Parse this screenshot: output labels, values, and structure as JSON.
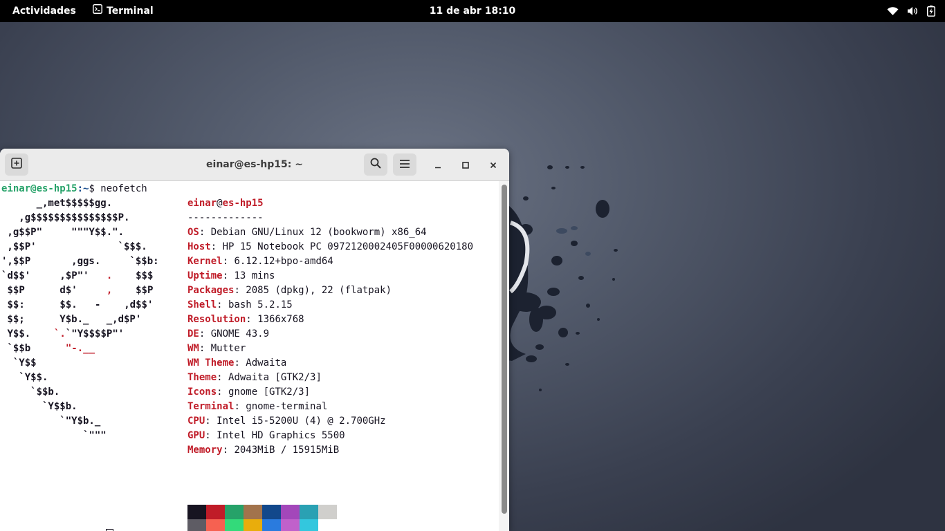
{
  "topbar": {
    "activities": "Actividades",
    "app_name": "Terminal",
    "clock": "11 de abr  18:10",
    "tray_icons": [
      "wifi-icon",
      "volume-icon",
      "battery-icon"
    ]
  },
  "window": {
    "title": "einar@es-hp15: ~",
    "buttons": [
      "new-tab-icon",
      "search-icon",
      "hamburger-menu-icon",
      "minimize-icon",
      "maximize-icon",
      "close-icon"
    ]
  },
  "terminal": {
    "prompt_user": "einar@es-hp15",
    "prompt_path": ":~",
    "prompt_symbol": "$ ",
    "command": "neofetch",
    "logo": [
      "      _,met$$$$$gg.",
      "   ,g$$$$$$$$$$$$$$$P.",
      " ,g$$P\"     \"\"\"Y$$.\".",
      " ,$$P'              `$$$.",
      "',$$P       ,ggs.     `$$b:",
      "`d$$'     ,$P\"'   .    $$$",
      " $$P      d$'     ,    $$P",
      " $$:      $$.   -    ,d$$'",
      " $$;      Y$b._   _,d$P'",
      " Y$$.    `.`\"Y$$$$P\"'",
      " `$$b      \"-.__",
      "  `Y$$",
      "   `Y$$.",
      "     `$$b.",
      "       `Y$$b.",
      "          `\"Y$b._",
      "              `\"\"\""
    ],
    "info_user": "einar",
    "info_at": "@",
    "info_host": "es-hp15",
    "separator": "-------------",
    "info": [
      {
        "key": "OS",
        "value": "Debian GNU/Linux 12 (bookworm) x86_64"
      },
      {
        "key": "Host",
        "value": "HP 15 Notebook PC 0972120002405F00000620180"
      },
      {
        "key": "Kernel",
        "value": "6.12.12+bpo-amd64"
      },
      {
        "key": "Uptime",
        "value": "13 mins"
      },
      {
        "key": "Packages",
        "value": "2085 (dpkg), 22 (flatpak)"
      },
      {
        "key": "Shell",
        "value": "bash 5.2.15"
      },
      {
        "key": "Resolution",
        "value": "1366x768"
      },
      {
        "key": "DE",
        "value": "GNOME 43.9"
      },
      {
        "key": "WM",
        "value": "Mutter"
      },
      {
        "key": "WM Theme",
        "value": "Adwaita"
      },
      {
        "key": "Theme",
        "value": "Adwaita [GTK2/3]"
      },
      {
        "key": "Icons",
        "value": "gnome [GTK2/3]"
      },
      {
        "key": "Terminal",
        "value": "gnome-terminal"
      },
      {
        "key": "CPU",
        "value": "Intel i5-5200U (4) @ 2.700GHz"
      },
      {
        "key": "GPU",
        "value": "Intel HD Graphics 5500"
      },
      {
        "key": "Memory",
        "value": "2043MiB / 15915MiB"
      }
    ],
    "palette_normal": [
      "#171421",
      "#c01c28",
      "#26a269",
      "#a2734c",
      "#12488b",
      "#a347ba",
      "#2aa1b3",
      "#d0cfcc"
    ],
    "palette_bright": [
      "#5e5c64",
      "#f66151",
      "#33da7a",
      "#e9ad0c",
      "#2a7bde",
      "#c061cb",
      "#33c7de"
    ]
  },
  "colors": {
    "topbar_bg": "#000000",
    "window_bg": "#ffffff",
    "headerbar_bg": "#ebebeb",
    "key_red": "#c01c28",
    "prompt_green": "#26a269"
  }
}
